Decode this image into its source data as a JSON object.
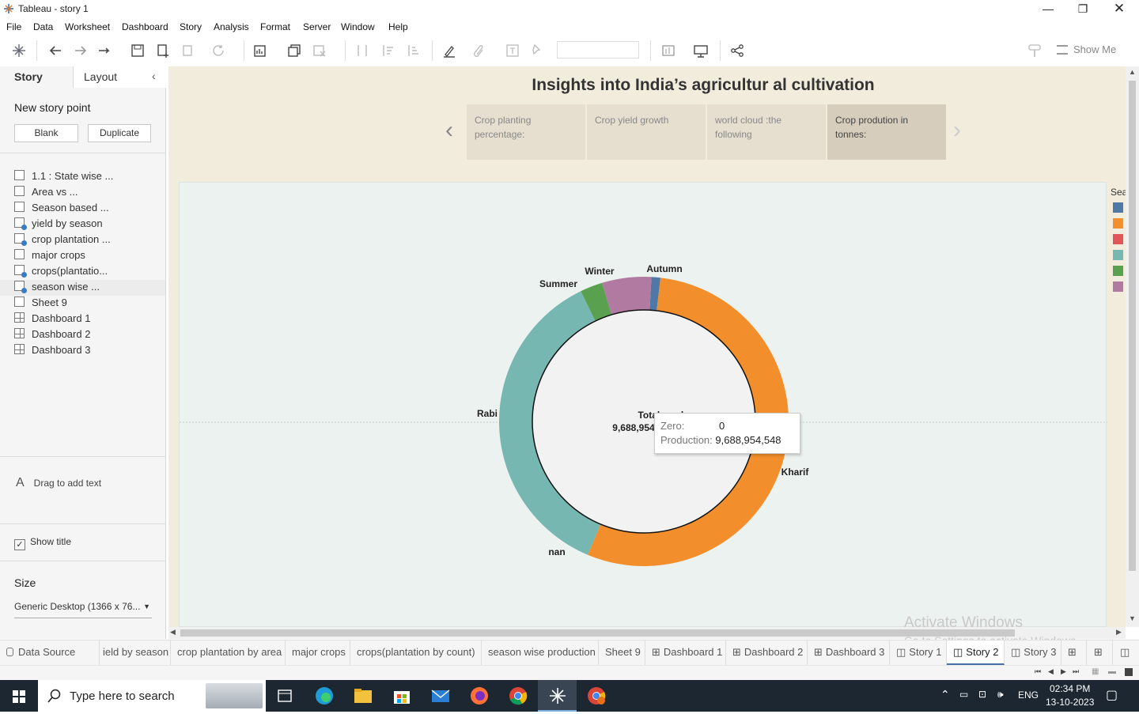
{
  "window": {
    "title": "Tableau - story 1"
  },
  "menu": [
    "File",
    "Data",
    "Worksheet",
    "Dashboard",
    "Story",
    "Analysis",
    "Format",
    "Server",
    "Window",
    "Help"
  ],
  "toolbar": {
    "show_me": "Show Me"
  },
  "left_pane": {
    "tab_story": "Story",
    "tab_layout": "Layout",
    "new_story_point": "New story point",
    "btn_blank": "Blank",
    "btn_duplicate": "Duplicate",
    "sheets": [
      {
        "label": "1.1 : State wise ...",
        "icon": "worksheet-icon"
      },
      {
        "label": "Area vs ...",
        "icon": "worksheet-icon"
      },
      {
        "label": "Season based ...",
        "icon": "worksheet-icon"
      },
      {
        "label": "yield by season",
        "icon": "worksheet-used-icon"
      },
      {
        "label": "crop plantation ...",
        "icon": "worksheet-used-icon"
      },
      {
        "label": "major crops",
        "icon": "worksheet-icon"
      },
      {
        "label": "crops(plantatio...",
        "icon": "worksheet-used-icon"
      },
      {
        "label": "season wise ...",
        "icon": "worksheet-used-icon"
      },
      {
        "label": "Sheet 9",
        "icon": "worksheet-icon"
      },
      {
        "label": "Dashboard 1",
        "icon": "dashboard-icon"
      },
      {
        "label": "Dashboard 2",
        "icon": "dashboard-icon"
      },
      {
        "label": "Dashboard 3",
        "icon": "dashboard-icon"
      }
    ],
    "drag_text": "Drag to add text",
    "show_title": "Show title",
    "size_label": "Size",
    "size_value": "Generic Desktop (1366 x 76..."
  },
  "story": {
    "title": "Insights into India’s agricultur al cultivation",
    "points": [
      {
        "line1": "Crop planting",
        "line2": "percentage:"
      },
      {
        "line1": "Crop yield growth",
        "line2": ""
      },
      {
        "line1": "world cloud :the",
        "line2": "following"
      },
      {
        "line1": "Crop prodution in",
        "line2": "tonnes:"
      }
    ]
  },
  "legend": {
    "title": "Sea",
    "colors": [
      "#4e79a7",
      "#f28e2b",
      "#e15759",
      "#76b7b2",
      "#59a14f",
      "#b07aa1"
    ]
  },
  "chart_data": {
    "type": "pie",
    "title": "",
    "center_label": "Total produ",
    "center_value": "9,688,954",
    "slices": [
      {
        "name": "Autumn",
        "value": 1.0,
        "color": "#4e79a7"
      },
      {
        "name": "Kharif",
        "value": 54.5,
        "color": "#f28e2b"
      },
      {
        "name": "nan",
        "value": 0.0,
        "color": "#e15759"
      },
      {
        "name": "Rabi",
        "value": 36.5,
        "color": "#76b7b2"
      },
      {
        "name": "Summer",
        "value": 2.5,
        "color": "#59a14f"
      },
      {
        "name": "Winter",
        "value": 5.5,
        "color": "#b07aa1"
      }
    ]
  },
  "tooltip": {
    "zero_key": "Zero:",
    "zero_value": "0",
    "production_key": "Production:",
    "production_value": "9,688,954,548"
  },
  "watermark": {
    "line1": "Activate Windows",
    "line2": "Go to Settings to activate Windows."
  },
  "tabs": [
    "Data Source",
    "ield by season",
    "crop plantation by area",
    "major crops",
    "crops(plantation by count)",
    "season wise production",
    "Sheet 9",
    "Dashboard 1",
    "Dashboard 2",
    "Dashboard 3",
    "Story 1",
    "Story 2",
    "Story 3"
  ],
  "taskbar": {
    "search_placeholder": "Type here to search",
    "lang": "ENG",
    "time": "02:34 PM",
    "date": "13-10-2023"
  }
}
